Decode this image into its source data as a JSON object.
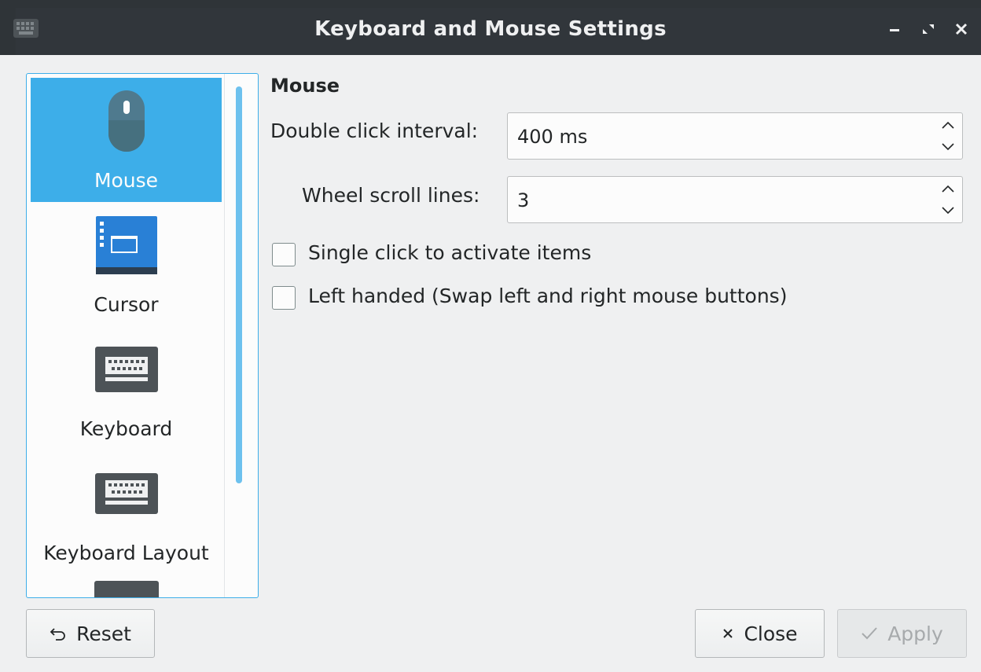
{
  "window": {
    "title": "Keyboard and Mouse Settings",
    "controls": [
      "minimize-icon",
      "maximize-icon",
      "close-icon"
    ],
    "app_icon": "keyboard-icon"
  },
  "sidebar": {
    "items": [
      {
        "label": "Mouse",
        "icon": "mouse-icon",
        "selected": true
      },
      {
        "label": "Cursor",
        "icon": "cursor-theme-icon",
        "selected": false
      },
      {
        "label": "Keyboard",
        "icon": "keyboard-icon",
        "selected": false
      },
      {
        "label": "Keyboard Layout",
        "icon": "keyboard-layout-icon",
        "selected": false
      }
    ]
  },
  "mouse": {
    "section_title": "Mouse",
    "double_click": {
      "label": "Double click interval:",
      "value": "400 ms"
    },
    "wheel_scroll": {
      "label": "Wheel scroll lines:",
      "value": "3"
    },
    "single_click": {
      "label": "Single click to activate items",
      "checked": false
    },
    "left_handed": {
      "label": "Left handed (Swap left and right mouse buttons)",
      "checked": false
    }
  },
  "buttons": {
    "reset": "Reset",
    "close": "Close",
    "apply": "Apply"
  },
  "colors": {
    "accent": "#3daee9",
    "titlebar": "#31363b",
    "window": "#eff0f1"
  }
}
